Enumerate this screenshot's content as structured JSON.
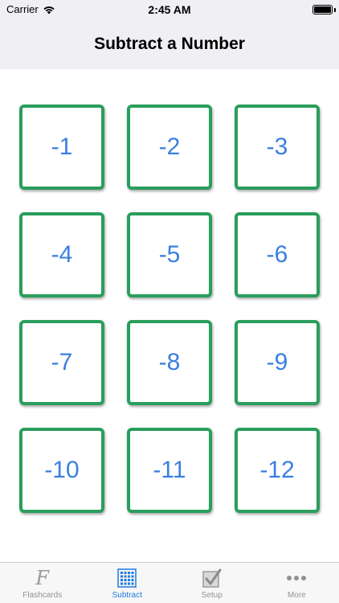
{
  "status_bar": {
    "carrier": "Carrier",
    "time": "2:45 AM"
  },
  "nav": {
    "title": "Subtract a Number"
  },
  "tiles": [
    {
      "label": "-1"
    },
    {
      "label": "-2"
    },
    {
      "label": "-3"
    },
    {
      "label": "-4"
    },
    {
      "label": "-5"
    },
    {
      "label": "-6"
    },
    {
      "label": "-7"
    },
    {
      "label": "-8"
    },
    {
      "label": "-9"
    },
    {
      "label": "-10"
    },
    {
      "label": "-11"
    },
    {
      "label": "-12"
    }
  ],
  "tab_bar": {
    "items": [
      {
        "label": "Flashcards",
        "icon": "flashcards-f-icon"
      },
      {
        "label": "Subtract",
        "icon": "grid-icon",
        "active": true
      },
      {
        "label": "Setup",
        "icon": "checkbox-icon"
      },
      {
        "label": "More",
        "icon": "more-dots-icon"
      }
    ]
  },
  "colors": {
    "tile_border": "#2a9e5c",
    "tile_text": "#3a7fe0",
    "active_tab": "#1d7be0",
    "inactive_tab": "#929292",
    "bar_background": "#efeff4"
  }
}
